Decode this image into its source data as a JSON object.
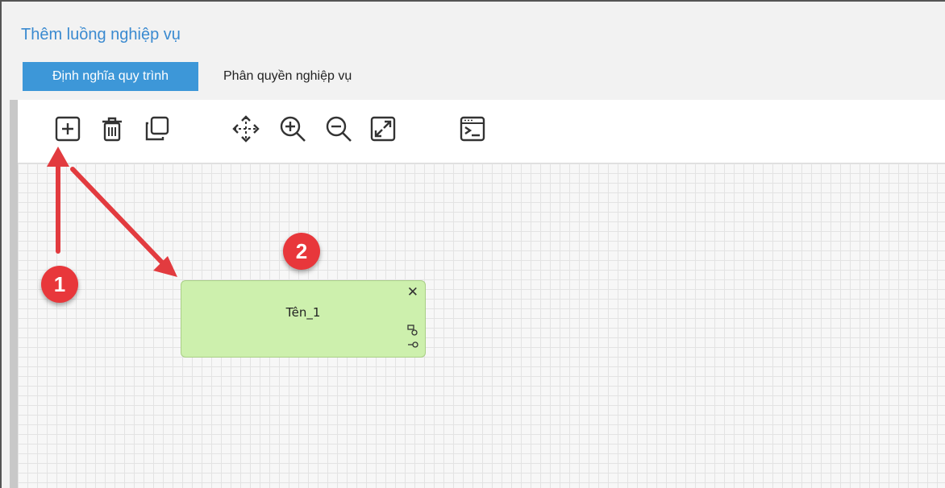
{
  "header": {
    "title": "Thêm luồng nghiệp vụ"
  },
  "tabs": [
    {
      "label": "Định nghĩa quy trình",
      "active": true
    },
    {
      "label": "Phân quyền nghiệp vụ",
      "active": false
    }
  ],
  "toolbar": {
    "icons": [
      "add-icon",
      "trash-icon",
      "copy-icon",
      "move-icon",
      "zoom-in-icon",
      "zoom-out-icon",
      "fit-screen-icon",
      "console-icon"
    ]
  },
  "node": {
    "label": "Tên_1",
    "close": "✕"
  },
  "annotations": {
    "badge_1": "1",
    "badge_2": "2"
  },
  "colors": {
    "accent": "#3d97d8",
    "node_fill": "#cdf0ad",
    "badge": "#e8373b"
  }
}
